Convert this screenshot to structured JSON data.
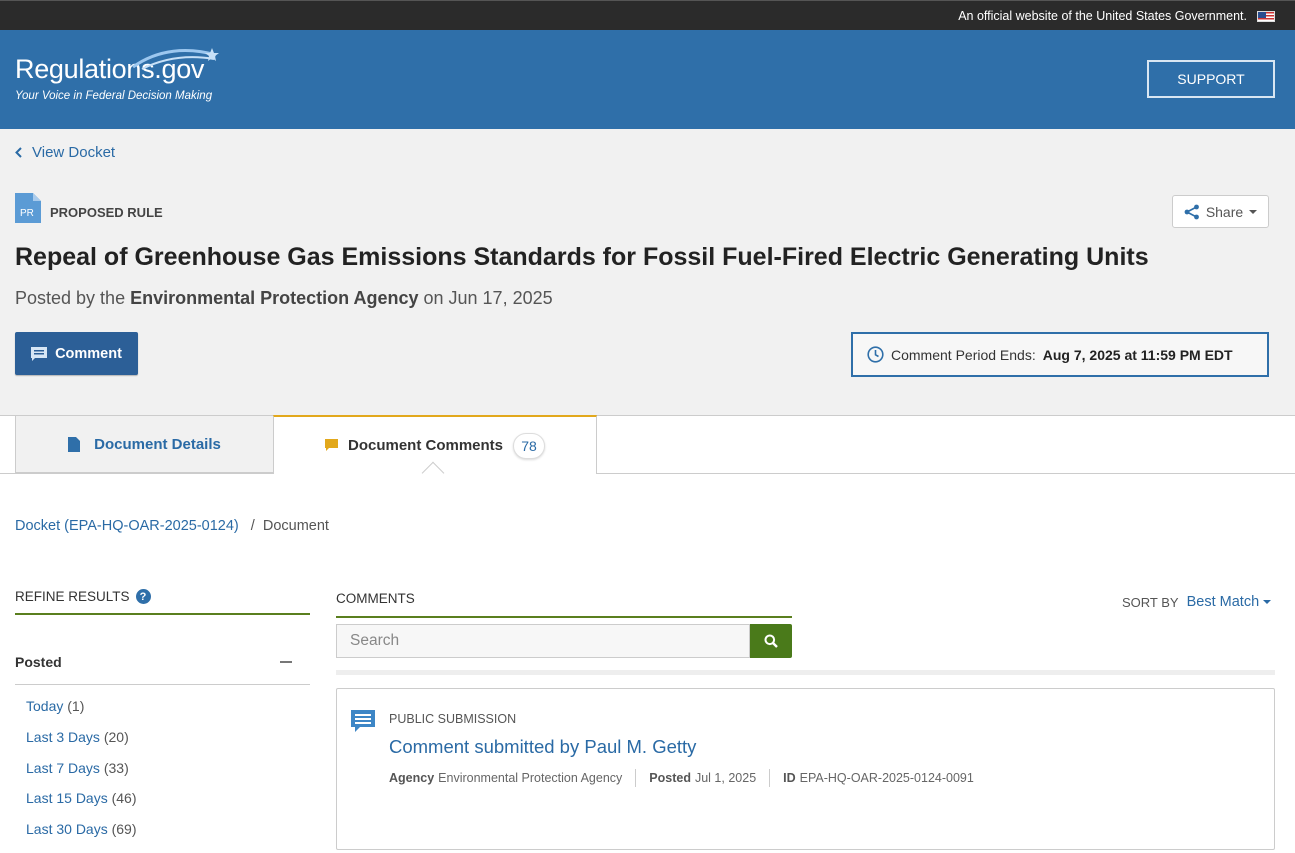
{
  "gov_banner": {
    "text": "An official website of the United States Government.",
    "flag_icon": "us-flag-icon"
  },
  "header": {
    "logo_text": "Regulations.gov",
    "tagline": "Your Voice in Federal Decision Making",
    "support_label": "SUPPORT",
    "bg_color": "#2f6fa9"
  },
  "hero": {
    "view_docket_label": "View Docket",
    "doc_type_abbr": "PR",
    "doc_type_label": "PROPOSED RULE",
    "share_label": "Share",
    "title": "Repeal of Greenhouse Gas Emissions Standards for Fossil Fuel-Fired Electric Generating Units",
    "posted_prefix": "Posted by the",
    "agency": "Environmental Protection Agency",
    "posted_suffix": "on Jun 17, 2025",
    "comment_button_label": "Comment",
    "comment_period_label": "Comment Period Ends:",
    "comment_period_value": "Aug 7, 2025 at 11:59 PM EDT"
  },
  "tabs": {
    "details_label": "Document Details",
    "comments_label": "Document Comments",
    "comments_count": "78",
    "active_color": "#e2a81c"
  },
  "breadcrumb": {
    "docket_link": "Docket (EPA-HQ-OAR-2025-0124)",
    "separator": "/",
    "current": "Document"
  },
  "sidebar": {
    "refine_title": "REFINE RESULTS",
    "facet_title": "Posted",
    "options": [
      {
        "label": "Today",
        "count": "(1)"
      },
      {
        "label": "Last 3 Days",
        "count": "(20)"
      },
      {
        "label": "Last 7 Days",
        "count": "(33)"
      },
      {
        "label": "Last 15 Days",
        "count": "(46)"
      },
      {
        "label": "Last 30 Days",
        "count": "(69)"
      }
    ]
  },
  "comments": {
    "section_title": "COMMENTS",
    "sort_label": "SORT BY",
    "sort_value": "Best Match",
    "search_placeholder": "Search",
    "accent_color": "#4a7a1a",
    "results": [
      {
        "type": "PUBLIC SUBMISSION",
        "title": "Comment submitted by Paul M. Getty",
        "agency_label": "Agency",
        "agency_value": "Environmental Protection Agency",
        "posted_label": "Posted",
        "posted_value": "Jul 1, 2025",
        "id_label": "ID",
        "id_value": "EPA-HQ-OAR-2025-0124-0091"
      }
    ]
  }
}
